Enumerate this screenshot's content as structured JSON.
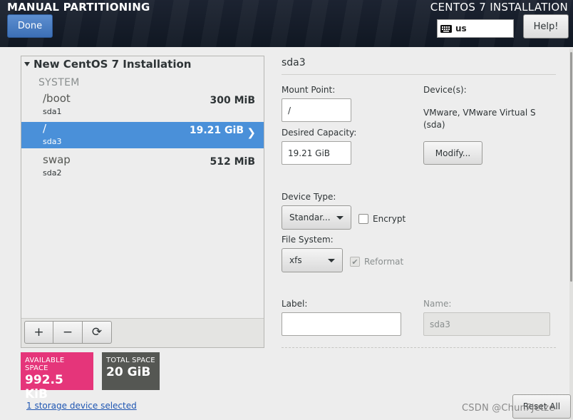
{
  "header": {
    "screen_title": "MANUAL PARTITIONING",
    "product_title": "CENTOS 7 INSTALLATION",
    "done_label": "Done",
    "keyboard_layout": "us",
    "help_label": "Help!"
  },
  "tree": {
    "installation_title": "New CentOS 7 Installation",
    "group_label": "SYSTEM",
    "mounts": [
      {
        "name": "/boot",
        "device": "sda1",
        "size": "300 MiB"
      },
      {
        "name": "/",
        "device": "sda3",
        "size": "19.21 GiB"
      },
      {
        "name": "swap",
        "device": "sda2",
        "size": "512 MiB"
      }
    ],
    "toolbar": {
      "add": "+",
      "remove": "−",
      "refresh": "⟳"
    }
  },
  "space": {
    "available_label": "AVAILABLE SPACE",
    "available_value": "992.5 KiB",
    "total_label": "TOTAL SPACE",
    "total_value": "20 GiB"
  },
  "storage_link": "1 storage device selected",
  "details": {
    "title": "sda3",
    "mount_point_label": "Mount Point:",
    "mount_point_value": "/",
    "capacity_label": "Desired Capacity:",
    "capacity_value": "19.21 GiB",
    "devices_label": "Device(s):",
    "devices_value": "VMware, VMware Virtual S (sda)",
    "modify_label": "Modify...",
    "device_type_label": "Device Type:",
    "device_type_value": "Standar...",
    "encrypt_label": "Encrypt",
    "file_system_label": "File System:",
    "file_system_value": "xfs",
    "reformat_label": "Reformat",
    "label_label": "Label:",
    "label_value": "",
    "name_label": "Name:",
    "name_value": "sda3"
  },
  "reset_label": "Reset All",
  "watermark": "CSDN @ChunFJetze",
  "colors": {
    "accent": "#4a90d9",
    "available": "#e5357a",
    "total": "#555753",
    "done_button": "#3c6fb6"
  }
}
